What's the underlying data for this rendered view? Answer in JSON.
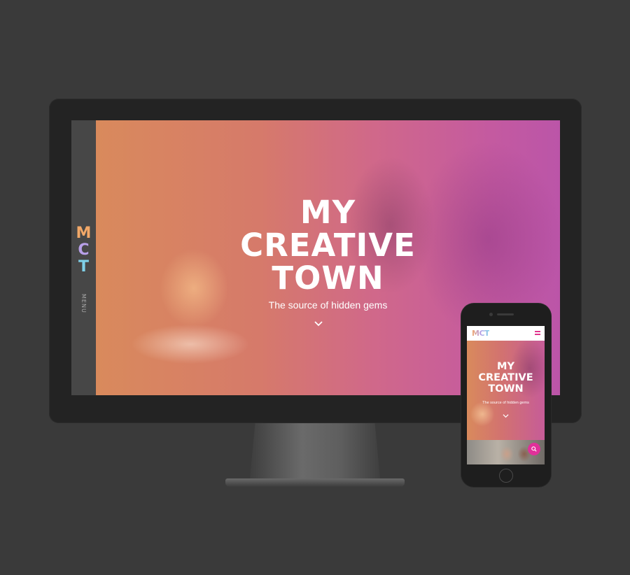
{
  "site": {
    "logo_letters": [
      "M",
      "C",
      "T"
    ],
    "logo_colors": [
      "#f2a868",
      "#b8a0e8",
      "#7fd0e8"
    ],
    "menu_label": "MENU",
    "hero": {
      "title_lines": [
        "MY",
        "CREATIVE",
        "TOWN"
      ],
      "subtitle": "The source of hidden gems",
      "scroll_icon": "chevron-down-icon"
    }
  },
  "mobile": {
    "logo": "MCT",
    "menu_icon": "hamburger-icon",
    "search_icon": "search-icon",
    "accent_color": "#e0309a"
  }
}
